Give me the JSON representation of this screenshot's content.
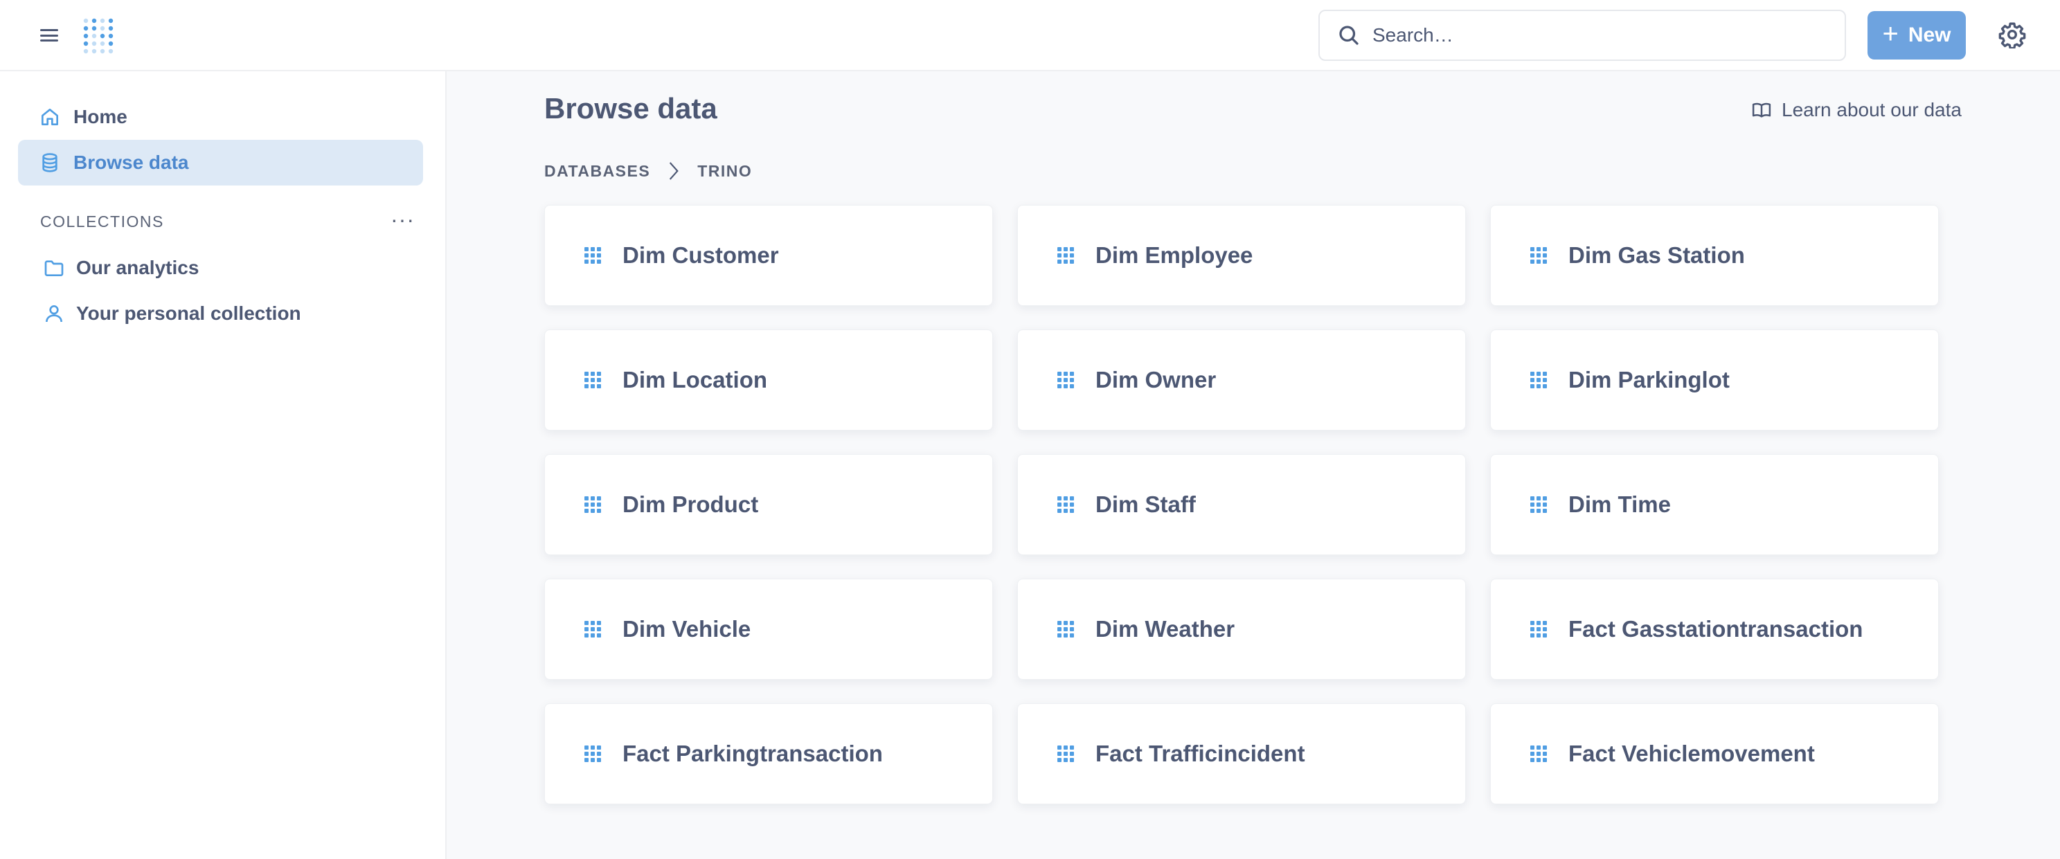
{
  "topbar": {
    "search": {
      "placeholder": "Search…"
    },
    "new_label": "New"
  },
  "icons": {
    "menu": "hamburger-icon",
    "logo": "metabase-logo",
    "search": "search-icon",
    "plus": "plus-icon",
    "settings": "gear-icon",
    "home": "home-icon",
    "database": "database-icon",
    "folder": "folder-icon",
    "person": "person-icon",
    "book": "book-icon",
    "chevron": "chevron-right-icon",
    "table": "table-grid-icon"
  },
  "sidebar": {
    "items": [
      {
        "label": "Home"
      },
      {
        "label": "Browse data"
      }
    ],
    "collections_header": "COLLECTIONS",
    "collections_menu": "···",
    "collections": [
      {
        "label": "Our analytics"
      },
      {
        "label": "Your personal collection"
      }
    ]
  },
  "main": {
    "title": "Browse data",
    "learn_link": "Learn about our data",
    "breadcrumb": [
      "DATABASES",
      "TRINO"
    ],
    "tables": [
      "Dim Customer",
      "Dim Employee",
      "Dim Gas Station",
      "Dim Location",
      "Dim Owner",
      "Dim Parkinglot",
      "Dim Product",
      "Dim Staff",
      "Dim Time",
      "Dim Vehicle",
      "Dim Weather",
      "Fact Gasstationtransaction",
      "Fact Parkingtransaction",
      "Fact Trafficincident",
      "Fact Vehiclemovement"
    ]
  },
  "colors": {
    "brand": "#509ee3",
    "button": "#6ea3df",
    "active_nav_bg": "#dde9f6",
    "text": "#4c5773",
    "background": "#f8f9fb"
  }
}
